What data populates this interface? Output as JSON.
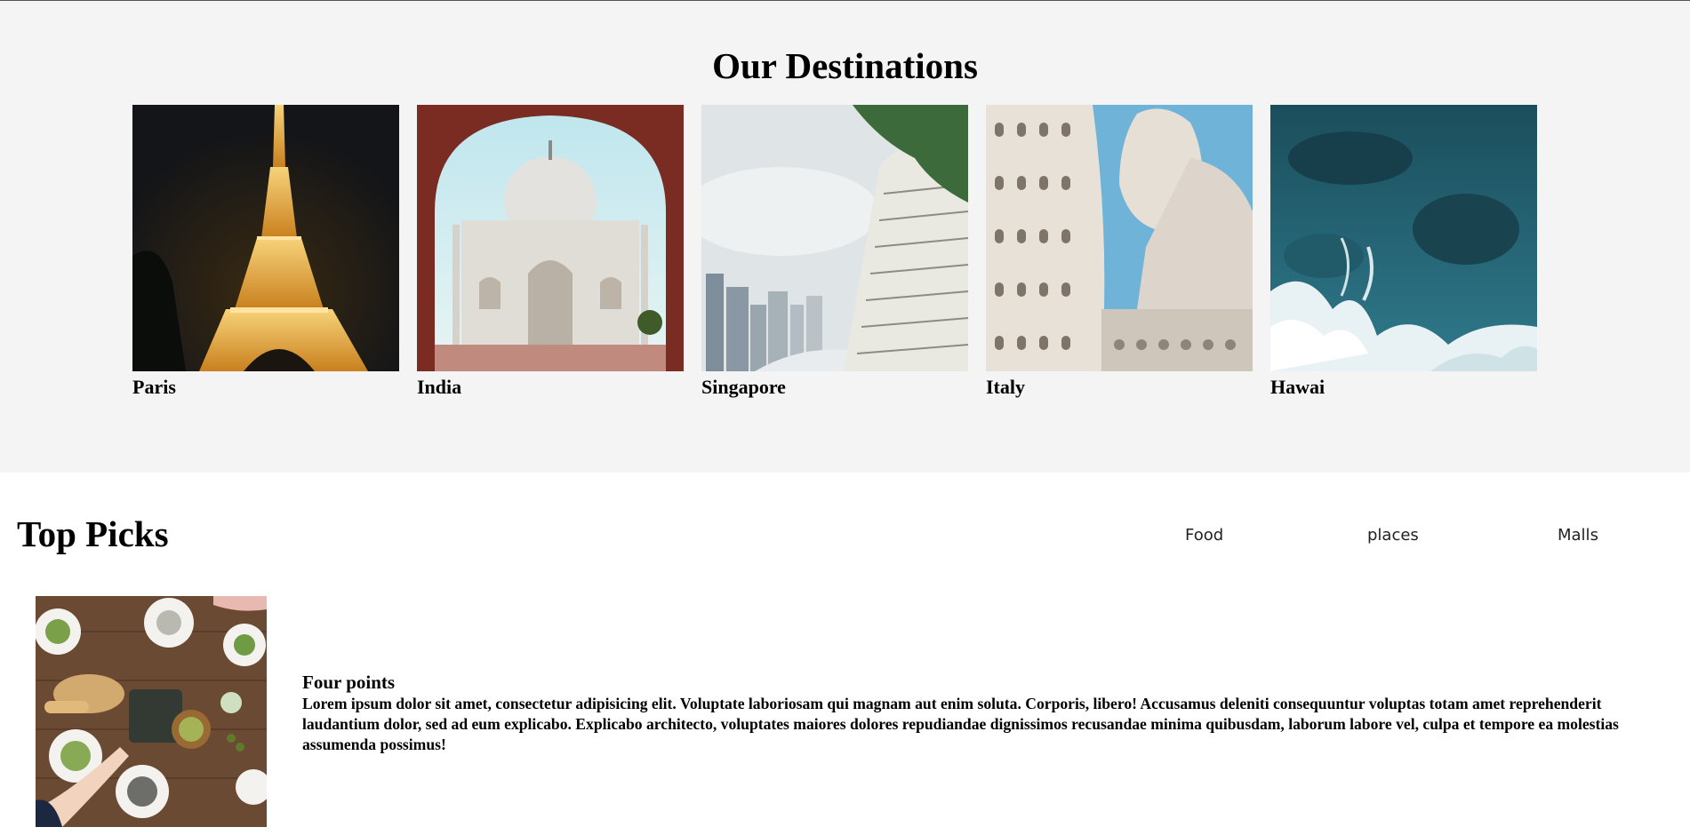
{
  "destinations": {
    "title": "Our Destinations",
    "items": [
      {
        "name": "Paris",
        "image": "eiffel-tower-photo"
      },
      {
        "name": "India",
        "image": "taj-mahal-photo"
      },
      {
        "name": "Singapore",
        "image": "singapore-skyline-photo"
      },
      {
        "name": "Italy",
        "image": "leaning-tower-pisa-photo"
      },
      {
        "name": "Hawai",
        "image": "ocean-waves-photo"
      }
    ]
  },
  "top_picks": {
    "title": "Top Picks",
    "tabs": [
      "Food",
      "places",
      "Malls"
    ],
    "card": {
      "image": "dining-table-photo",
      "name": "Four points",
      "description": "Lorem ipsum dolor sit amet, consectetur adipisicing elit. Voluptate laboriosam qui magnam aut enim soluta. Corporis, libero! Accusamus deleniti consequuntur voluptas totam amet reprehenderit laudantium dolor, sed ad eum explicabo. Explicabo architecto, voluptates maiores dolores repudiandae dignissimos recusandae minima quibusdam, laborum labore vel, culpa et tempore ea molestias assumenda possimus!"
    }
  },
  "colors": {
    "section_background": "#f4f4f4",
    "page_background": "#ffffff",
    "text": "#000000"
  }
}
